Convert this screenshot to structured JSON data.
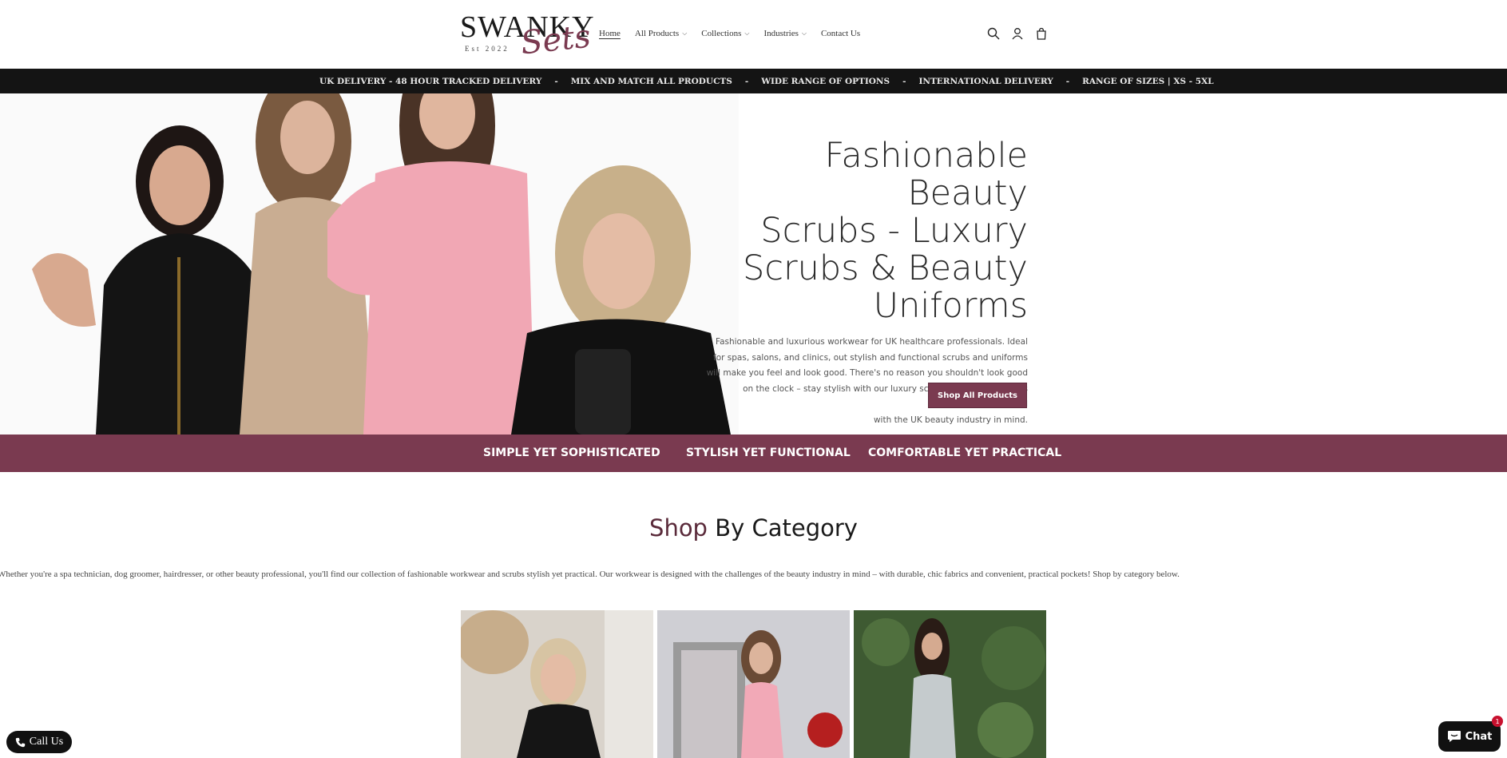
{
  "brand": {
    "logo_word": "SWANKY",
    "logo_script": "Sets",
    "logo_est": "Est 2022"
  },
  "nav": {
    "items": [
      {
        "label": "Home",
        "active": true,
        "dropdown": false
      },
      {
        "label": "All Products",
        "active": false,
        "dropdown": true
      },
      {
        "label": "Collections",
        "active": false,
        "dropdown": true
      },
      {
        "label": "Industries",
        "active": false,
        "dropdown": true
      },
      {
        "label": "Contact Us",
        "active": false,
        "dropdown": false
      }
    ],
    "icons": [
      "search-icon",
      "account-icon",
      "cart-icon"
    ]
  },
  "announcement": {
    "items": [
      "UK DELIVERY - 48 HOUR TRACKED DELIVERY",
      "MIX AND MATCH ALL PRODUCTS",
      "WIDE RANGE OF OPTIONS",
      "INTERNATIONAL DELIVERY",
      "RANGE OF SIZES | XS - 5XL"
    ],
    "separator": "-"
  },
  "hero": {
    "title_lines": [
      "Fashionable Beauty",
      "Scrubs - Luxury",
      "Scrubs & Beauty",
      "Uniforms"
    ],
    "description_lines": [
      "Fashionable and luxurious workwear for UK healthcare professionals. Ideal",
      "for spas, salons, and clinics, out stylish and functional scrubs and uniforms",
      "will make you feel and look good. There's no reason you shouldn't look good",
      "on the clock – stay stylish with our luxury scrubs and work uniforms designed",
      "with the UK beauty industry in mind."
    ],
    "button_label": "Shop All Products"
  },
  "strip": {
    "items": [
      "SIMPLE YET SOPHISTICATED",
      "STYLISH YET FUNCTIONAL",
      "COMFORTABLE YET PRACTICAL"
    ]
  },
  "category": {
    "title_accent": "Shop",
    "title_rest": " By Category",
    "description": "Whether you're a spa technician, dog groomer, hairdresser, or other beauty professional, you'll find our collection of fashionable workwear and scrubs stylish yet practical. Our workwear is designed with the challenges of the beauty industry in mind – with durable, chic fabrics and convenient, practical pockets! Shop by category below."
  },
  "floating": {
    "call_label": "Call Us",
    "chat_label": "Chat",
    "chat_badge": "1"
  },
  "colors": {
    "brand": "#7a3a50",
    "announcement_bg": "#141414",
    "text": "#2a2a2a"
  }
}
